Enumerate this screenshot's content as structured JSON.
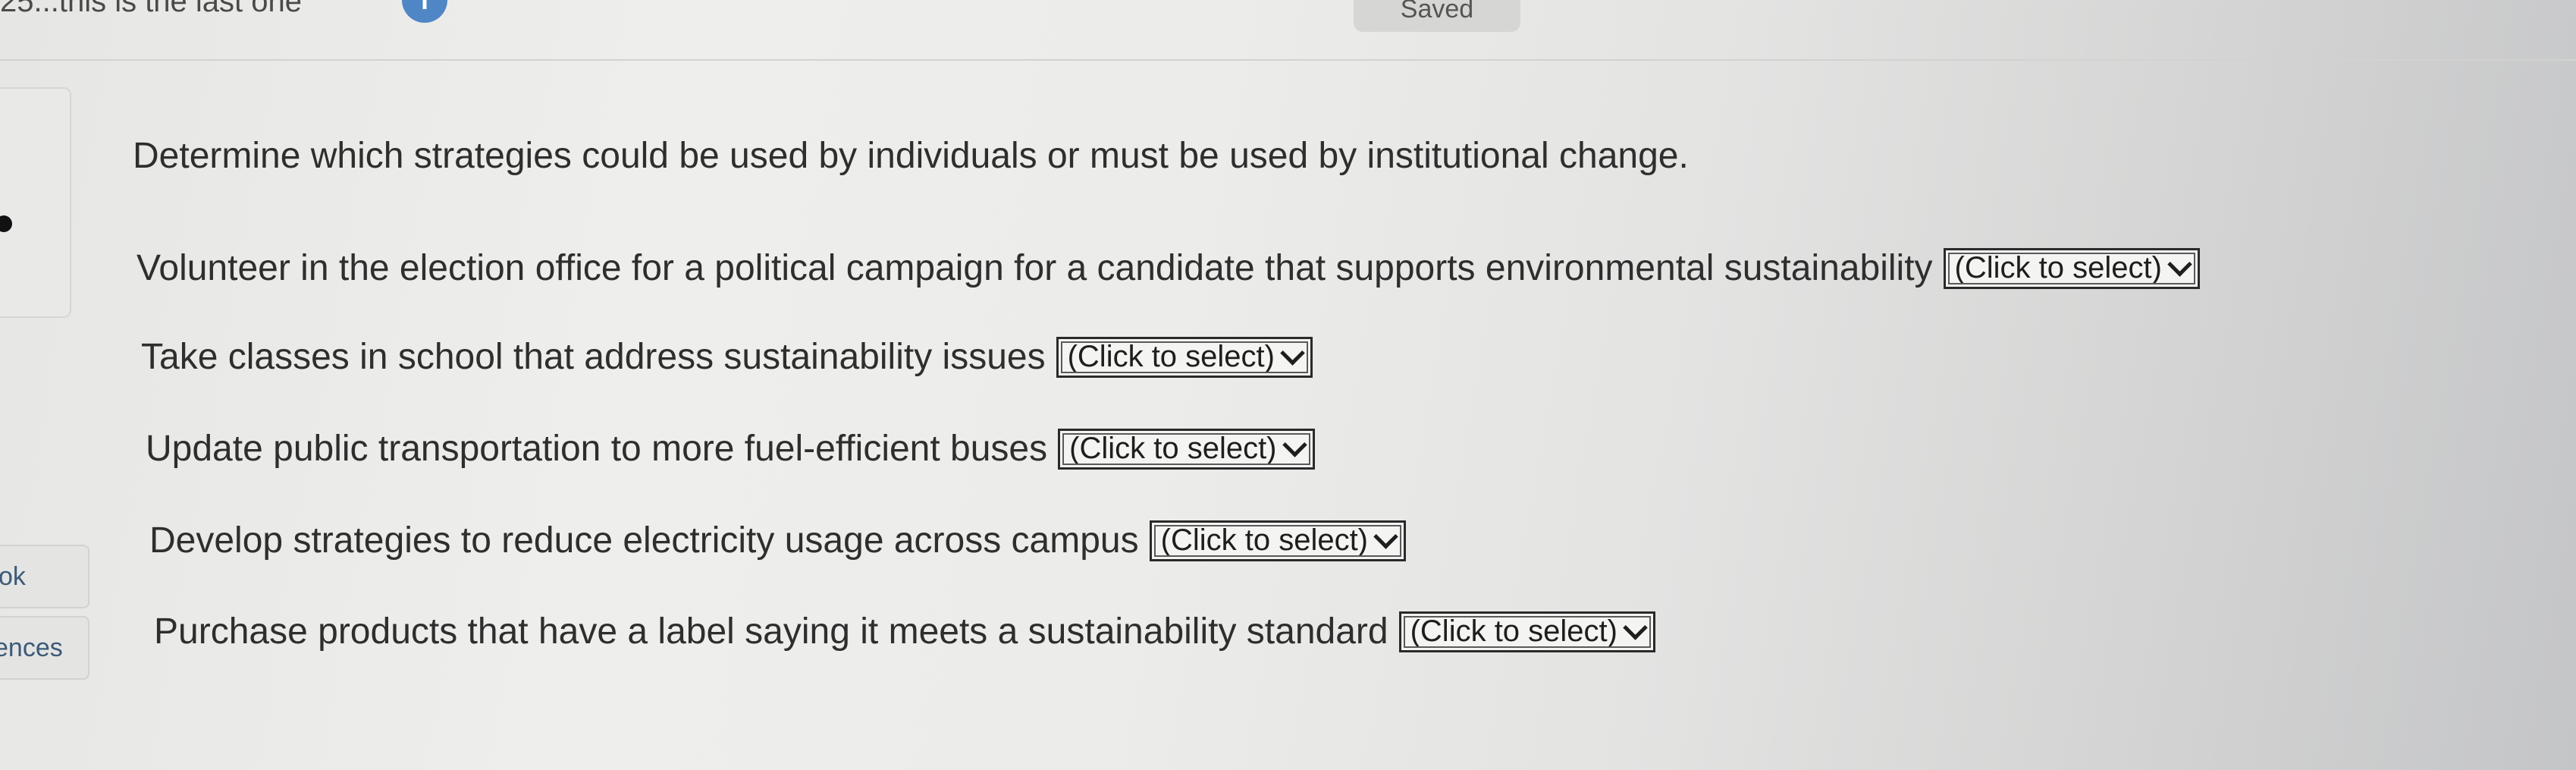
{
  "header": {
    "title": "25...this is the last one",
    "info_icon": "i",
    "saved_label": "Saved"
  },
  "sidebar": {
    "tab1_label": "ok",
    "tab2_label": "ences"
  },
  "question": {
    "instruction": "Determine which strategies could be used by individuals or must be used by institutional change.",
    "items": [
      {
        "text": "Volunteer in the election office for a political campaign for a candidate that supports environmental sustainability",
        "select": "(Click to select)"
      },
      {
        "text": "Take classes in school that address sustainability issues",
        "select": "(Click to select)"
      },
      {
        "text": "Update public transportation to more fuel-efficient buses",
        "select": "(Click to select)"
      },
      {
        "text": "Develop strategies to reduce electricity usage across campus",
        "select": "(Click to select)"
      },
      {
        "text": "Purchase products that have a label saying it meets a sustainability standard",
        "select": "(Click to select)"
      }
    ]
  },
  "icons": {
    "info": "info-icon",
    "dropdown": "chevron-down-icon"
  },
  "colors": {
    "info_icon": "#4f86c6",
    "text": "#2e2e2e"
  }
}
